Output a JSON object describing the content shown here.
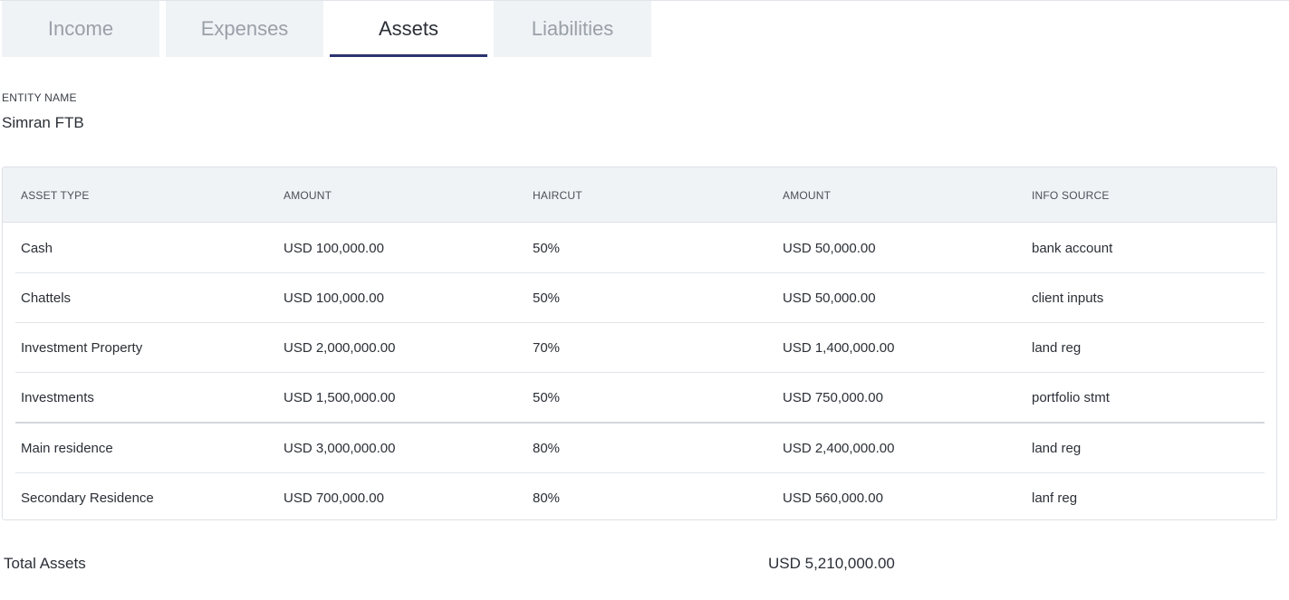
{
  "tabs": [
    {
      "label": "Income",
      "active": false
    },
    {
      "label": "Expenses",
      "active": false
    },
    {
      "label": "Assets",
      "active": true
    },
    {
      "label": "Liabilities",
      "active": false
    }
  ],
  "entity": {
    "label": "ENTITY NAME",
    "value": "Simran FTB"
  },
  "table": {
    "headers": [
      "ASSET TYPE",
      "AMOUNT",
      "HAIRCUT",
      "AMOUNT",
      "INFO SOURCE"
    ],
    "rows": [
      [
        "Cash",
        "USD 100,000.00",
        "50%",
        "USD 50,000.00",
        "bank account"
      ],
      [
        "Chattels",
        "USD 100,000.00",
        "50%",
        "USD 50,000.00",
        "client inputs"
      ],
      [
        "Investment Property",
        "USD 2,000,000.00",
        "70%",
        "USD 1,400,000.00",
        "land reg"
      ],
      [
        "Investments",
        "USD 1,500,000.00",
        "50%",
        "USD 750,000.00",
        "portfolio stmt"
      ],
      [
        "Main residence",
        "USD 3,000,000.00",
        "80%",
        "USD 2,400,000.00",
        "land reg"
      ],
      [
        "Secondary Residence",
        "USD 700,000.00",
        "80%",
        "USD 560,000.00",
        "lanf reg"
      ]
    ]
  },
  "total": {
    "label": "Total Assets",
    "value": "USD 5,210,000.00"
  },
  "colors": {
    "accent": "#2b3270",
    "tab_bg": "#f0f3f6",
    "header_bg": "#f0f3f6"
  }
}
